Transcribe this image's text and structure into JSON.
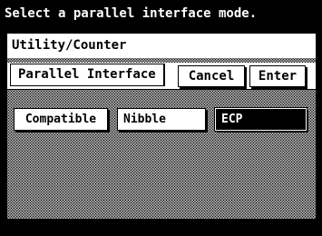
{
  "prompt": "Select a parallel interface mode.",
  "breadcrumb": "Utility/Counter",
  "screen_title": "Parallel Interface",
  "buttons": {
    "cancel": "Cancel",
    "enter": "Enter"
  },
  "options": [
    {
      "label": "Compatible",
      "selected": false
    },
    {
      "label": "Nibble",
      "selected": false
    },
    {
      "label": "ECP",
      "selected": true
    }
  ],
  "colors": {
    "background": "#000000",
    "panel": "#ffffff",
    "selected": "#000000"
  }
}
